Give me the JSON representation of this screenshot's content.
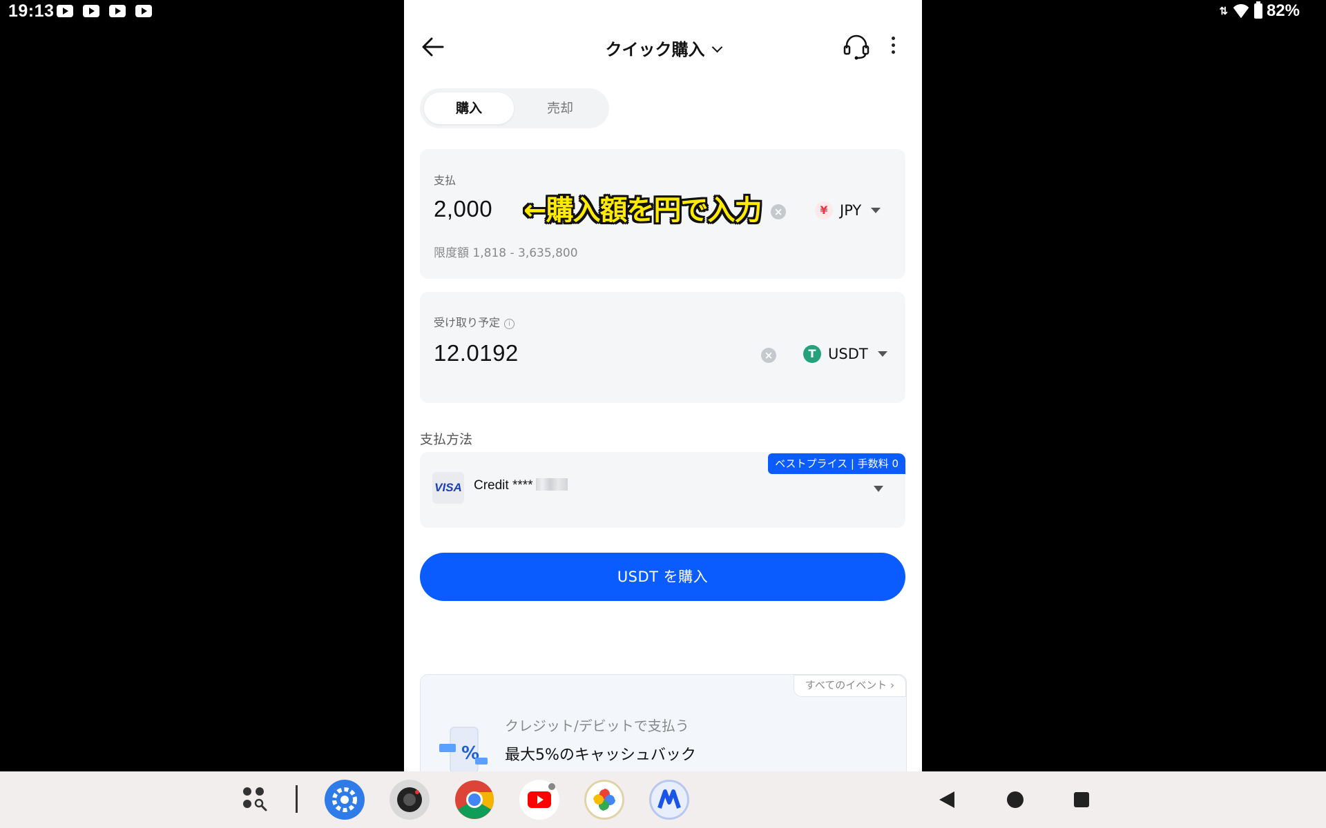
{
  "status_bar": {
    "time": "19:13",
    "battery": "82%"
  },
  "header": {
    "title": "クイック購入"
  },
  "tabs": {
    "buy": "購入",
    "sell": "売却"
  },
  "pay": {
    "label": "支払",
    "amount": "2,000",
    "currency": "JPY",
    "currency_symbol": "¥",
    "limit": "限度額 1,818 - 3,635,800",
    "annotation": "←購入額を円で入力"
  },
  "receive": {
    "label": "受け取り予定",
    "amount": "12.0192",
    "currency": "USDT",
    "currency_symbol": "T"
  },
  "payment_method": {
    "label": "支払方法",
    "badge": "ベストプライス | 手数料 0",
    "card_brand": "VISA",
    "card_text": "Credit ****"
  },
  "cta": {
    "label": "USDT を購入"
  },
  "promo": {
    "all_events": "すべてのイベント ›",
    "subtitle": "クレジット/デビットで支払う",
    "title": "最大5%のキャッシュバック"
  },
  "colors": {
    "primary": "#0a5cff",
    "usdt_green": "#26a17b",
    "jpy_red": "#e8334a",
    "annotation_yellow": "#ffeb00"
  }
}
